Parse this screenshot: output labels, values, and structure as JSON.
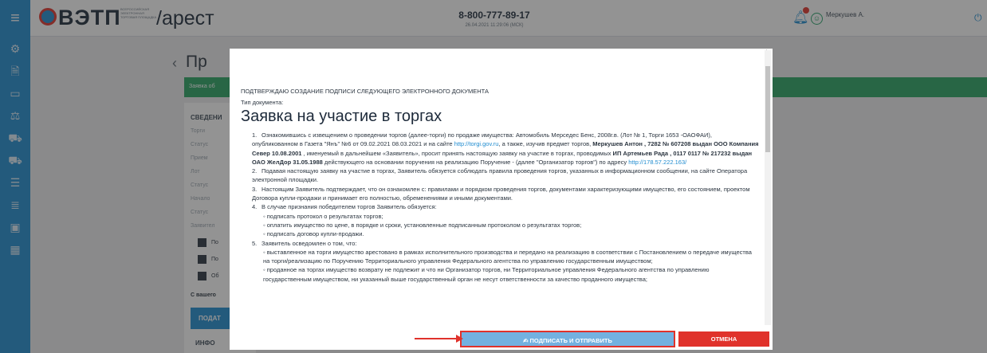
{
  "header": {
    "brand": "ВЭТП",
    "brand_sub": "ВСЕРОССИЙСКАЯ ЭЛЕКТРОННАЯ ТОРГОВАЯ ПЛОЩАДКА",
    "site_section": "/арест",
    "phone": "8-800-777-89-17",
    "datetime": "26.04.2021 11:29:06 (МСК)",
    "user_name": "Меркушев А.",
    "user_role": "",
    "menu_icon": "menu-icon",
    "bell_icon": "bell-icon",
    "user_icon": "user-icon",
    "power_icon": "power-icon"
  },
  "sidebar": {
    "icons": [
      "gear-icon",
      "document-icon",
      "card-icon",
      "scales-icon",
      "truck-icon",
      "truck-icon",
      "book-icon",
      "list-icon",
      "briefcase-icon",
      "calendar-icon"
    ]
  },
  "background": {
    "breadcrumb": "",
    "page_title": "Пр",
    "green_banner": "Заявка об",
    "panel_heading": "СВЕДЕНИ",
    "fields": [
      "Торги",
      "Статус",
      "Прием",
      "Лот",
      "Статус",
      "Начало",
      "Статус",
      "Заявител"
    ],
    "checkbox_labels": [
      "По",
      "По",
      "Об"
    ],
    "note": "С вашего",
    "submit_label": "ПОДАТ",
    "info_heading": "ИНФО"
  },
  "modal": {
    "confirm_line": "ПОДТВЕРЖДАЮ СОЗДАНИЕ ПОДПИСИ СЛЕДУЮЩЕГО ЭЛЕКТРОННОГО ДОКУМЕНТА",
    "doc_type_label": "Тип документа:",
    "doc_title": "Заявка на участие в торгах",
    "item1": {
      "part1": "Ознакомившись с извещением о проведении торгов (далее-торги) по продаже имущества: Автомобиль Мерседес Бенс, 2008г.в. (Лот № 1, Торги 1653 -ОАОФАИ), опубликованном в Газета \"Янъ\" №6 от 09.02.2021 08.03.2021 и на сайте ",
      "link1": "http://torgi.gov.ru",
      "part2": ", а также, изучив предмет торгов, ",
      "bold1": "Меркушев Антон , 7282 № 607208 выдан ООО Компания Север 10.08.2001",
      "part3": " , именуемый в дальнейшем «Заявитель», просит принять настоящую заявку на участие в торгах, проводимых ",
      "bold2": "ИП Артемьев Рада , 0117 0117 № 217232 выдан ОАО ЖелДор 31.05.1988",
      "part4": " действующего на основании поручения на реализацию Поручение - (далее \"Организатор торгов\") по адресу ",
      "link2": "http://178.57.222.163/"
    },
    "item2": "Подавая настоящую заявку на участие в торгах, Заявитель обязуется соблюдать правила проведения торгов, указанных в информационном сообщении, на сайте Оператора электронной площадки.",
    "item3": "Настоящим Заявитель подтверждает, что он ознакомлен с: правилами и порядком проведения торгов, документами характеризующими имущество, его состоянием, проектом Договора купли-продажи и принимает его полностью, обременениями и иными документами.",
    "item4": "В случае признания победителем торгов Заявитель обязуется:",
    "item4_subs": [
      "подписать протокол о результатах торгов;",
      "оплатить имущество по цене, в порядке и сроки, установленные подписанным протоколом о результатах торгов;",
      "подписать договор купли-продажи."
    ],
    "item5": "Заявитель осведомлен о том, что:",
    "item5_subs": [
      "выставленное на торги имущество арестовано в рамках исполнительного производства и передано на реализацию в соответствии с Постановлением о передаче имущества на торги/реализацию по Поручению Территориального управления Федерального агентства по управлению государственным имуществом;",
      "проданное на торгах имущество возврату не подлежит и что ни Организатор торгов, ни Территориальное управления Федерального агентства по управлению государственным имуществом, ни указанный выше государственный орган не несут ответственности за качество проданного имущества;"
    ],
    "sign_button": "ПОДПИСАТЬ И ОТПРАВИТЬ",
    "sign_icon": "signature-icon",
    "cancel_button": "ОТМЕНА"
  },
  "accent_colors": {
    "brand_blue": "#1f8cd0",
    "success_green": "#29a563",
    "danger_red": "#e0322b"
  }
}
